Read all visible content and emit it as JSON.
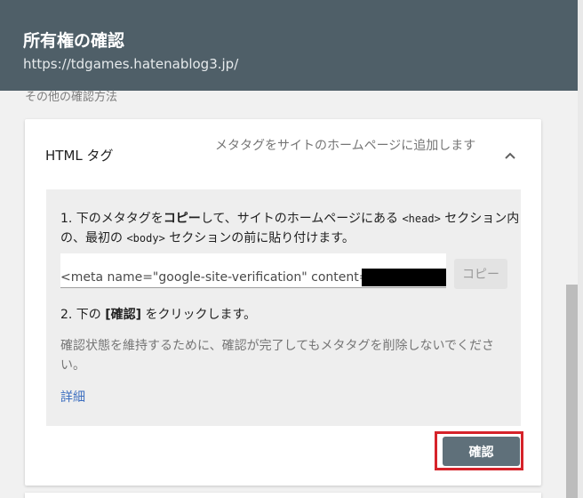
{
  "dialog": {
    "title": "所有権の確認",
    "subtitle": "https://tdgames.hatenablog3.jp/"
  },
  "cut_off_label": "その他の確認方法",
  "method": {
    "name": "HTML タグ",
    "description": "メタタグをサイトのホームページに追加します",
    "expand_icon": "chevron-up-icon"
  },
  "instructions": {
    "step1_a": "1. 下のメタタグを",
    "step1_b": "コピー",
    "step1_c": "して、サイトのホームページにある ",
    "step1_code1": "<head>",
    "step1_d": " セクション内の、最初の ",
    "step1_code2": "<body>",
    "step1_e": " セクションの前に貼り付けます。",
    "meta_tag": "<meta name=\"google-site-verification\" content=\"",
    "copy_button": "コピー",
    "step2_a": "2. 下の ",
    "step2_b": "[確認]",
    "step2_c": " をクリックします。",
    "note": "確認状態を維持するために、確認が完了してもメタタグを削除しないでください。",
    "details_link": "詳細"
  },
  "confirm_button": "確認",
  "colors": {
    "header_bg": "#4f5f68",
    "confirm_bg": "#5f707a",
    "highlight": "#d6232a",
    "link": "#3d6fc0"
  }
}
